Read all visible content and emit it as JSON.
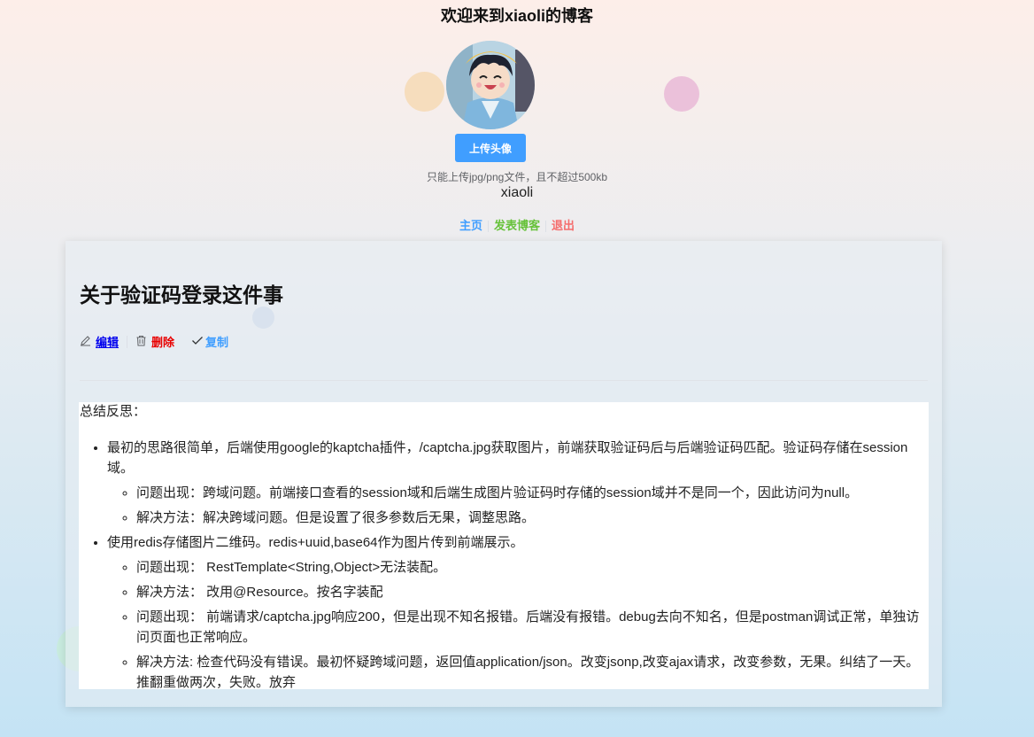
{
  "site_title": "欢迎来到xiaoli的博客",
  "profile": {
    "upload_button": "上传头像",
    "upload_tip": "只能上传jpg/png文件，且不超过500kb",
    "username": "xiaoli"
  },
  "nav": {
    "home": "主页",
    "publish": "发表博客",
    "logout": "退出"
  },
  "post": {
    "title": "关于验证码登录这件事",
    "actions": {
      "edit": "编辑",
      "delete": "删除",
      "copy": "复制"
    },
    "intro": "总结反思：",
    "items": [
      {
        "text": "最初的思路很简单，后端使用google的kaptcha插件，/captcha.jpg获取图片，前端获取验证码后与后端验证码匹配。验证码存储在session域。",
        "sub": [
          "问题出现：跨域问题。前端接口查看的session域和后端生成图片验证码时存储的session域并不是同一个，因此访问为null。",
          "解决方法：解决跨域问题。但是设置了很多参数后无果，调整思路。"
        ]
      },
      {
        "text": "使用redis存储图片二维码。redis+uuid,base64作为图片传到前端展示。",
        "sub": [
          "问题出现：  RestTemplate<String,Object>无法装配。",
          "解决方法：  改用@Resource。按名字装配",
          "问题出现：  前端请求/captcha.jpg响应200，但是出现不知名报错。后端没有报错。debug去向不知名，但是postman调试正常，单独访问页面也正常响应。",
          "解决方法: 检查代码没有错误。最初怀疑跨域问题，返回值application/json。改变jsonp,改变ajax请求，改变参数，无果。纠结了一天。推翻重做两次，失败。放弃"
        ]
      }
    ]
  },
  "colors": {
    "primary": "#409eff",
    "success": "#67c23a",
    "danger": "#f56c6c",
    "delete": "#e80000",
    "link": "#0000ee"
  },
  "icons": {
    "edit": "pencil-icon",
    "delete": "trash-icon",
    "copy": "check-icon"
  }
}
